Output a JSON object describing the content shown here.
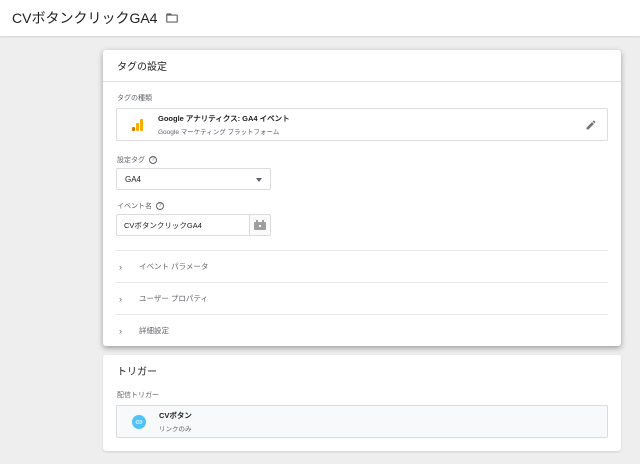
{
  "header": {
    "title": "CVボタンクリックGA4",
    "folder_icon": "folder-icon"
  },
  "tag_config": {
    "heading": "タグの設定",
    "type_label": "タグの種類",
    "type": {
      "name": "Google アナリティクス: GA4 イベント",
      "platform": "Google マーケティング プラットフォーム",
      "icon": "google-analytics-icon"
    },
    "config_tag_label": "設定タグ",
    "config_tag_value": "GA4",
    "event_name_label": "イベント名",
    "event_name_value": "CVボタンクリックGA4",
    "sections": [
      "イベント パラメータ",
      "ユーザー プロパティ",
      "詳細設定"
    ]
  },
  "trigger": {
    "heading": "トリガー",
    "firing_label": "配信トリガー",
    "item": {
      "name": "CVボタン",
      "type": "リンクのみ",
      "icon": "link-icon"
    }
  },
  "colors": {
    "ga_orange": "#f9ab00",
    "ga_dark_orange": "#e37400",
    "trigger_blue": "#4fc3f7"
  }
}
